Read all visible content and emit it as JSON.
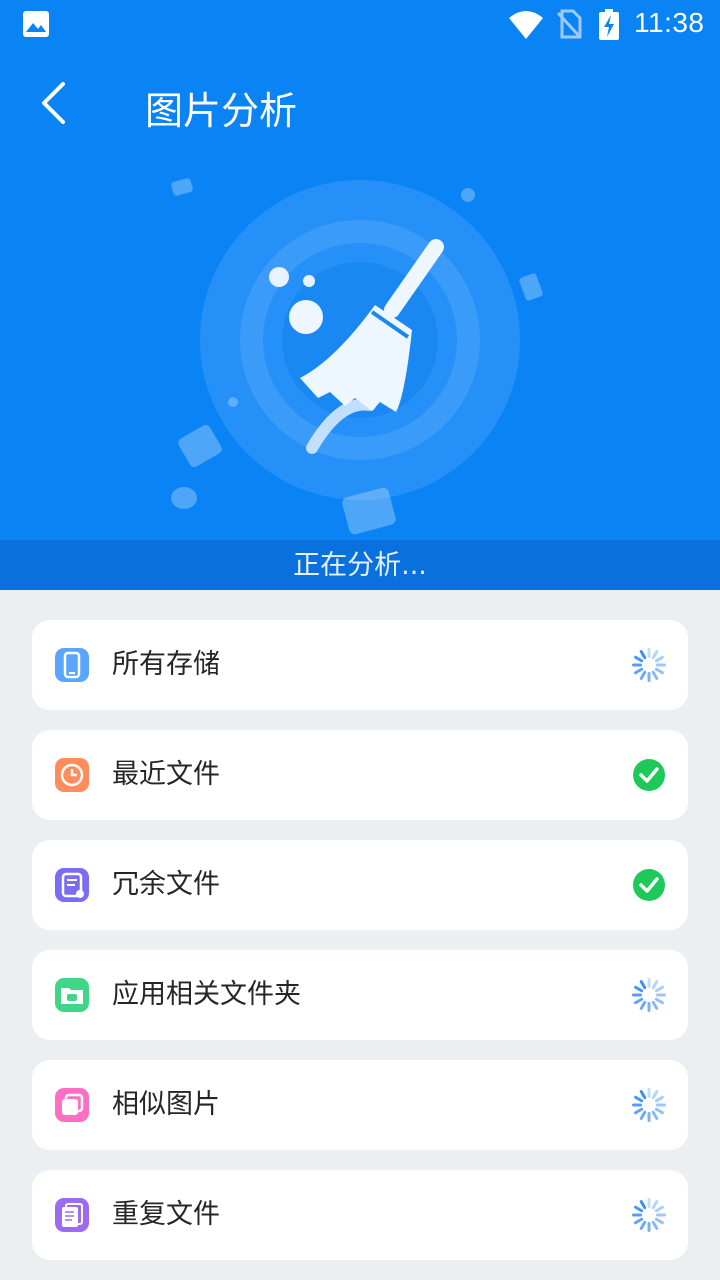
{
  "status_bar": {
    "time": "11:38",
    "icons": [
      "image-notification-icon",
      "wifi-icon",
      "no-sim-icon",
      "battery-charging-icon"
    ]
  },
  "header": {
    "title": "图片分析",
    "back_icon": "back-arrow-icon"
  },
  "hero": {
    "illustration": "broom-clean-icon",
    "status_text": "正在分析..."
  },
  "colors": {
    "hero_bg": "#0a84f5",
    "status_strip_bg": "#0a70dd",
    "page_bg": "#eceff2",
    "done_green": "#1ec95a",
    "spinner_blue": "#3d8ef0"
  },
  "items": [
    {
      "label": "所有存储",
      "icon": "phone-storage-icon",
      "icon_color": "#5aa6ff",
      "status": "loading"
    },
    {
      "label": "最近文件",
      "icon": "clock-icon",
      "icon_color": "#ff8c5a",
      "status": "done"
    },
    {
      "label": "冗余文件",
      "icon": "document-icon",
      "icon_color": "#7b6cf6",
      "status": "done"
    },
    {
      "label": "应用相关文件夹",
      "icon": "android-folder-icon",
      "icon_color": "#3fd68a",
      "status": "loading"
    },
    {
      "label": "相似图片",
      "icon": "similar-images-icon",
      "icon_color": "#ff6fc1",
      "status": "loading"
    },
    {
      "label": "重复文件",
      "icon": "duplicate-files-icon",
      "icon_color": "#9c6bf0",
      "status": "loading"
    }
  ]
}
